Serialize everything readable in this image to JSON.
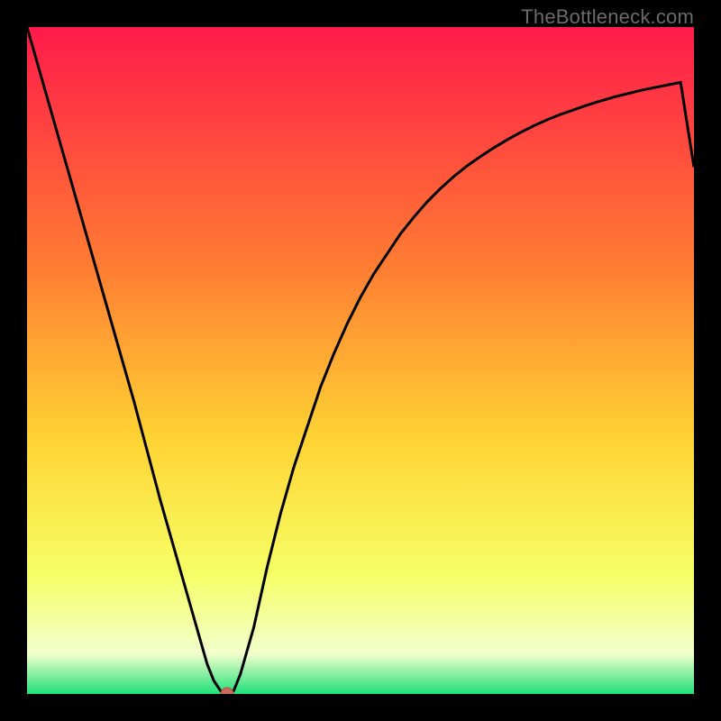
{
  "attribution": "TheBottleneck.com",
  "colors": {
    "top": "#ff1a4a",
    "mid_upper": "#ff7a33",
    "mid": "#ffd433",
    "mid_lower": "#f6ff66",
    "pale": "#f2ffcc",
    "bottom": "#20e07a",
    "curve": "#000000",
    "dot_fill": "#c96a5d",
    "dot_stroke": "#b25448"
  },
  "chart_data": {
    "type": "line",
    "title": "",
    "xlabel": "",
    "ylabel": "",
    "xlim": [
      0,
      100
    ],
    "ylim": [
      0,
      100
    ],
    "x": [
      0,
      2,
      4,
      6,
      8,
      10,
      12,
      14,
      16,
      18,
      20,
      22,
      24,
      26,
      27,
      28,
      29,
      30,
      31,
      32,
      34,
      36,
      38,
      40,
      42,
      44,
      46,
      48,
      50,
      52,
      54,
      56,
      58,
      60,
      62,
      64,
      66,
      68,
      70,
      72,
      74,
      76,
      78,
      80,
      82,
      84,
      86,
      88,
      90,
      92,
      94,
      96,
      98,
      100
    ],
    "values": [
      100,
      93,
      86,
      79,
      72,
      65,
      58,
      51,
      44,
      36.5,
      29,
      22,
      15,
      8,
      4.5,
      2,
      0.5,
      0,
      0.5,
      3,
      10,
      19,
      27,
      34,
      40,
      46,
      51,
      55.5,
      59.5,
      63,
      66,
      69,
      71.5,
      73.8,
      75.8,
      77.6,
      79.2,
      80.6,
      81.9,
      83.1,
      84.2,
      85.2,
      86.1,
      86.9,
      87.6,
      88.3,
      88.9,
      89.5,
      90,
      90.5,
      90.9,
      91.3,
      91.7,
      79
    ],
    "marker": {
      "x": 30,
      "y": 0
    },
    "grid": false,
    "legend": false
  }
}
